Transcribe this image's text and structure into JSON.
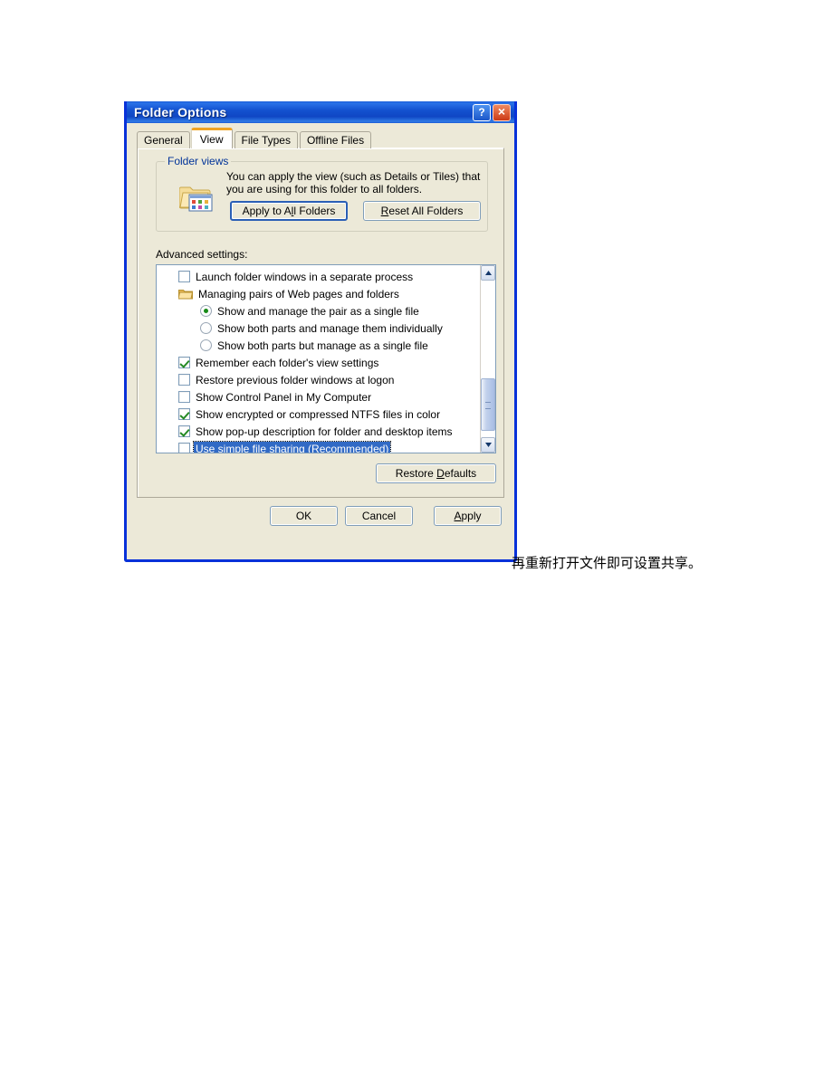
{
  "window": {
    "title": "Folder Options",
    "help_button": "?",
    "close_button": "×"
  },
  "tabs": [
    {
      "label": "General",
      "active": false
    },
    {
      "label": "View",
      "active": true
    },
    {
      "label": "File Types",
      "active": false
    },
    {
      "label": "Offline Files",
      "active": false
    }
  ],
  "folder_views": {
    "legend": "Folder views",
    "description": "You can apply the view (such as Details or Tiles) that you are using for this folder to all folders.",
    "apply_all_label": "Apply to All Folders",
    "apply_all_accel": "A",
    "reset_all_label": "Reset All Folders",
    "reset_all_accel": "R"
  },
  "advanced": {
    "label": "Advanced settings:",
    "items": [
      {
        "type": "checkbox",
        "checked": false,
        "indent": 1,
        "text": "Launch folder windows in a separate process",
        "selected": false
      },
      {
        "type": "folder",
        "checked": false,
        "indent": 1,
        "text": "Managing pairs of Web pages and folders",
        "selected": false
      },
      {
        "type": "radio",
        "checked": true,
        "indent": 2,
        "text": "Show and manage the pair as a single file",
        "selected": false
      },
      {
        "type": "radio",
        "checked": false,
        "indent": 2,
        "text": "Show both parts and manage them individually",
        "selected": false
      },
      {
        "type": "radio",
        "checked": false,
        "indent": 2,
        "text": "Show both parts but manage as a single file",
        "selected": false
      },
      {
        "type": "checkbox",
        "checked": true,
        "indent": 1,
        "text": "Remember each folder's view settings",
        "selected": false
      },
      {
        "type": "checkbox",
        "checked": false,
        "indent": 1,
        "text": "Restore previous folder windows at logon",
        "selected": false
      },
      {
        "type": "checkbox",
        "checked": false,
        "indent": 1,
        "text": "Show Control Panel in My Computer",
        "selected": false
      },
      {
        "type": "checkbox",
        "checked": true,
        "indent": 1,
        "text": "Show encrypted or compressed NTFS files in color",
        "selected": false
      },
      {
        "type": "checkbox",
        "checked": true,
        "indent": 1,
        "text": "Show pop-up description for folder and desktop items",
        "selected": false
      },
      {
        "type": "checkbox",
        "checked": false,
        "indent": 1,
        "text": "Use simple file sharing (Recommended)",
        "selected": true
      }
    ],
    "scrollbar": {
      "up_arrow": "▲",
      "down_arrow": "▼"
    }
  },
  "restore_defaults": {
    "label": "Restore Defaults",
    "accel": "D"
  },
  "bottom_buttons": {
    "ok": "OK",
    "cancel": "Cancel",
    "apply": "Apply",
    "apply_accel": "A"
  },
  "colors": {
    "title_blue": "#0831d9",
    "dialog_face": "#ece9d8",
    "selection_blue": "#316ac5",
    "active_tab_accent": "#f0a423",
    "group_legend": "#003399",
    "check_green": "#258a25"
  },
  "page_text": {
    "continuation": "再重新打开文件即可设置共享。"
  }
}
